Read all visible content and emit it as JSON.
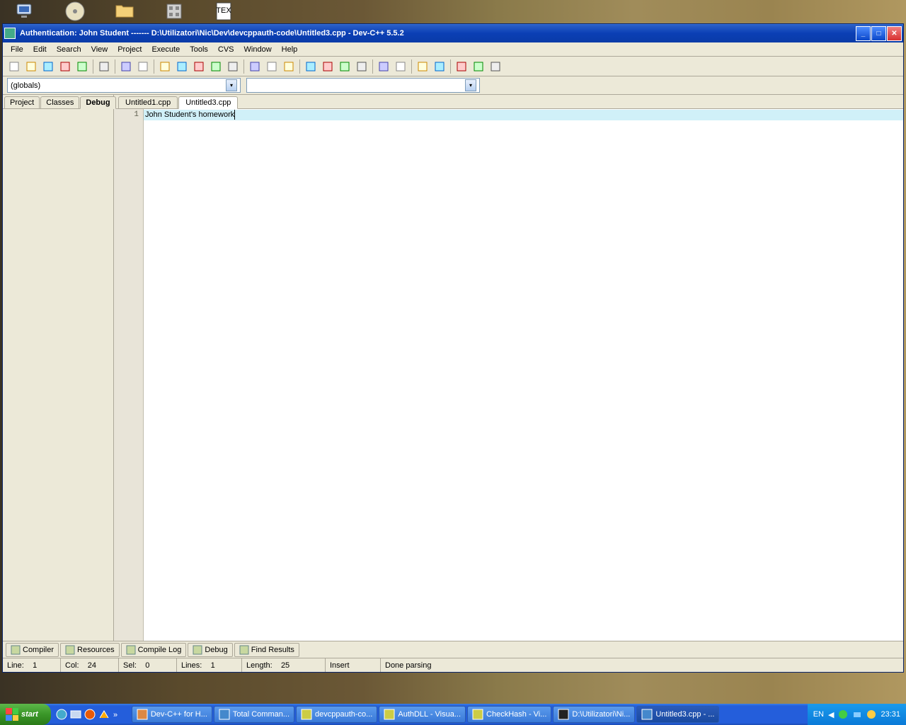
{
  "desktop_icons": [
    "my-computer",
    "cd-rom",
    "folder",
    "app",
    "tex"
  ],
  "window": {
    "title": "Authentication: John Student ------- D:\\Utilizatori\\Nic\\Dev\\devcppauth-code\\Untitled3.cpp - Dev-C++ 5.5.2"
  },
  "menu": [
    "File",
    "Edit",
    "Search",
    "View",
    "Project",
    "Execute",
    "Tools",
    "CVS",
    "Window",
    "Help"
  ],
  "toolbar_groups": [
    [
      "new-file",
      "open",
      "save",
      "save-all",
      "close"
    ],
    [
      "print"
    ],
    [
      "undo",
      "redo"
    ],
    [
      "find",
      "replace",
      "find-in-files",
      "goto-shell",
      "goto-line"
    ],
    [
      "back",
      "forward",
      "bookmark-add"
    ],
    [
      "toggle-project",
      "toggle-class",
      "toggle-debug",
      "toggle-panels"
    ],
    [
      "compile-ok",
      "compile-cancel"
    ],
    [
      "profile",
      "debug-run"
    ],
    [
      "window-next",
      "window-prev",
      "window-close"
    ]
  ],
  "combo1_value": "(globals)",
  "combo2_value": "",
  "left_tabs": [
    "Project",
    "Classes",
    "Debug"
  ],
  "left_tab_active": 2,
  "editor_tabs": [
    "Untitled1.cpp",
    "Untitled3.cpp"
  ],
  "editor_tab_active": 1,
  "code": {
    "line_number": "1",
    "line_text": "John Student's homework"
  },
  "bottom_tabs": [
    {
      "icon": "compiler-icon",
      "label": "Compiler"
    },
    {
      "icon": "resources-icon",
      "label": "Resources"
    },
    {
      "icon": "compile-log-icon",
      "label": "Compile Log"
    },
    {
      "icon": "debug-icon",
      "label": "Debug"
    },
    {
      "icon": "find-results-icon",
      "label": "Find Results"
    }
  ],
  "status": {
    "line_label": "Line:",
    "line_val": "1",
    "col_label": "Col:",
    "col_val": "24",
    "sel_label": "Sel:",
    "sel_val": "0",
    "lines_label": "Lines:",
    "lines_val": "1",
    "length_label": "Length:",
    "length_val": "25",
    "insert": "Insert",
    "parse": "Done parsing"
  },
  "taskbar": {
    "start": "start",
    "items": [
      {
        "label": "Dev-C++ for H...",
        "color": "#d84"
      },
      {
        "label": "Total Comman...",
        "color": "#48c"
      },
      {
        "label": "devcppauth-co...",
        "color": "#cc4"
      },
      {
        "label": "AuthDLL - Visua...",
        "color": "#cc4"
      },
      {
        "label": "CheckHash - Vi...",
        "color": "#cc4"
      },
      {
        "label": "D:\\Utilizatori\\Ni...",
        "color": "#222"
      },
      {
        "label": "Untitled3.cpp - ...",
        "color": "#48c",
        "active": true
      }
    ],
    "lang": "EN",
    "time": "23:31"
  }
}
